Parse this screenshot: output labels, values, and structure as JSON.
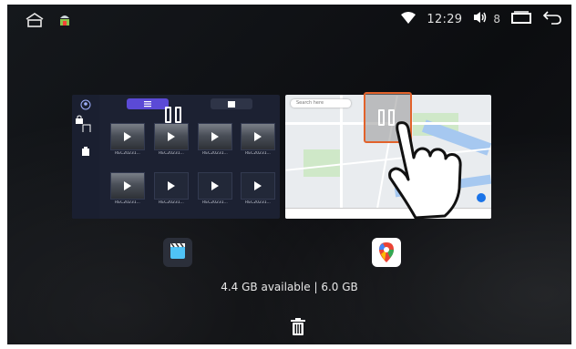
{
  "statusbar": {
    "left_icons": [
      "home-icon",
      "android-debug-icon"
    ],
    "time": "12:29",
    "volume_level": "8",
    "right_icons": [
      "wifi-icon",
      "volume-icon",
      "recent-apps-icon",
      "back-icon"
    ]
  },
  "recents": {
    "cards": [
      {
        "app": "dashcam-recorder",
        "tabs": [
          "list-tab-icon",
          "folder-tab-icon"
        ],
        "thumbnails": [
          {
            "label": "REC20231...",
            "has_preview": true
          },
          {
            "label": "REC20231...",
            "has_preview": true
          },
          {
            "label": "REC20231...",
            "has_preview": true
          },
          {
            "label": "REC20231...",
            "has_preview": true
          },
          {
            "label": "REC20231...",
            "has_preview": true
          },
          {
            "label": "REC20231...",
            "has_preview": false
          },
          {
            "label": "REC20231...",
            "has_preview": false
          },
          {
            "label": "REC20231...",
            "has_preview": false
          }
        ]
      },
      {
        "app": "google-maps",
        "search_placeholder": "Search here"
      }
    ],
    "split_screen_icon": "split-screen-icon",
    "gesture": "tap-hand-icon",
    "highlight_color": "#e2622b"
  },
  "storage_text": "4.4 GB available | 6.0 GB",
  "clear_all_icon": "trash-icon",
  "colors": {
    "background": "#101215",
    "accent_purple": "#5b4ad6"
  }
}
